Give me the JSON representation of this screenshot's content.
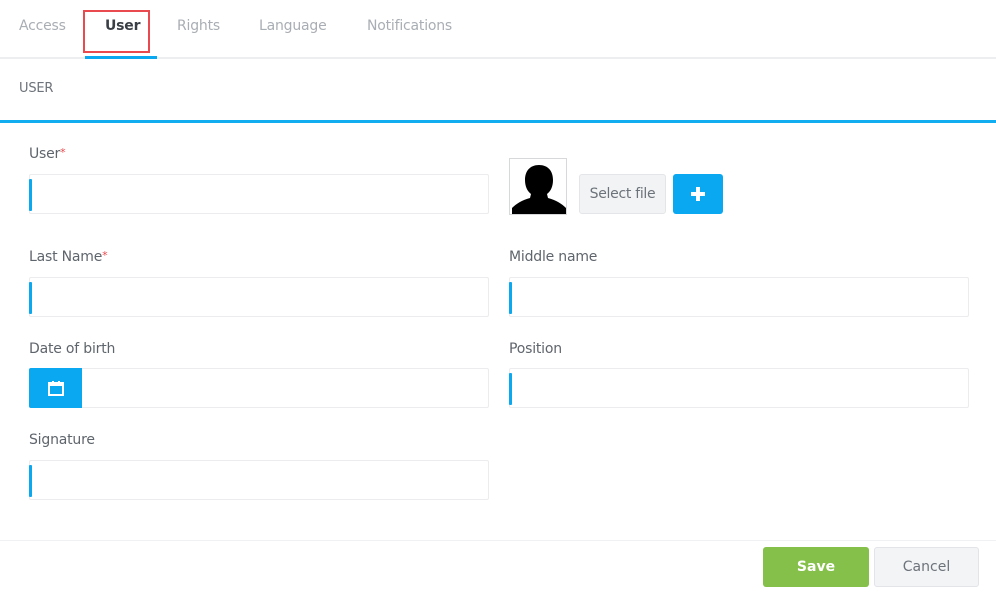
{
  "tabs": [
    {
      "label": "Access",
      "active": false
    },
    {
      "label": "User",
      "active": true
    },
    {
      "label": "Rights",
      "active": false
    },
    {
      "label": "Language",
      "active": false
    },
    {
      "label": "Notifications",
      "active": false
    }
  ],
  "section": {
    "title": "USER"
  },
  "colors": {
    "accent": "#0aa8f0",
    "save": "#85c04a",
    "required": "#e84a4f",
    "highlight": "#e84a4f"
  },
  "form": {
    "user": {
      "label": "User",
      "required_mark": "*",
      "value": ""
    },
    "photo": {
      "select_label": "Select file",
      "add_icon": "plus-icon",
      "avatar_icon": "user-silhouette-icon"
    },
    "last_name": {
      "label": "Last Name",
      "required_mark": "*",
      "value": ""
    },
    "middle_name": {
      "label": "Middle name",
      "value": ""
    },
    "date_of_birth": {
      "label": "Date of birth",
      "value": "",
      "icon": "calendar-icon"
    },
    "position": {
      "label": "Position",
      "value": ""
    },
    "signature": {
      "label": "Signature",
      "value": ""
    }
  },
  "actions": {
    "save": "Save",
    "cancel": "Cancel"
  }
}
